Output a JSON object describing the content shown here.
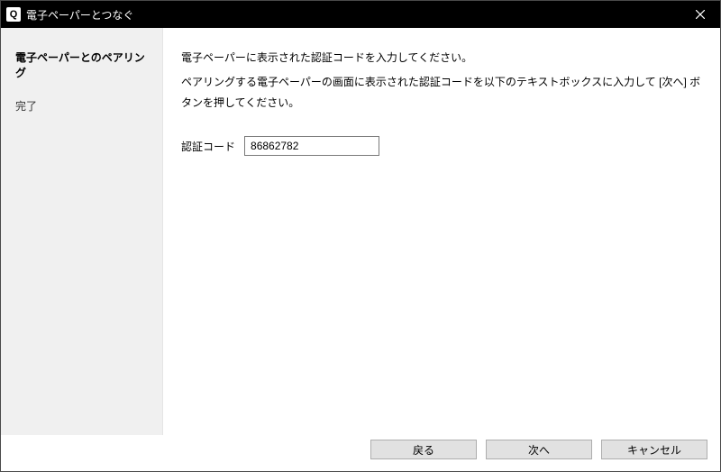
{
  "window": {
    "title": "電子ペーパーとつなぐ",
    "icon_letter": "Q"
  },
  "sidebar": {
    "steps": [
      {
        "label": "電子ペーパーとのペアリング",
        "active": true
      },
      {
        "label": "完了",
        "active": false
      }
    ]
  },
  "main": {
    "line1": "電子ペーパーに表示された認証コードを入力してください。",
    "line2": "ペアリングする電子ペーパーの画面に表示された認証コードを以下のテキストボックスに入力して [次へ] ボタンを押してください。",
    "code_label": "認証コード",
    "code_value": "86862782"
  },
  "footer": {
    "back": "戻る",
    "next": "次へ",
    "cancel": "キャンセル"
  }
}
